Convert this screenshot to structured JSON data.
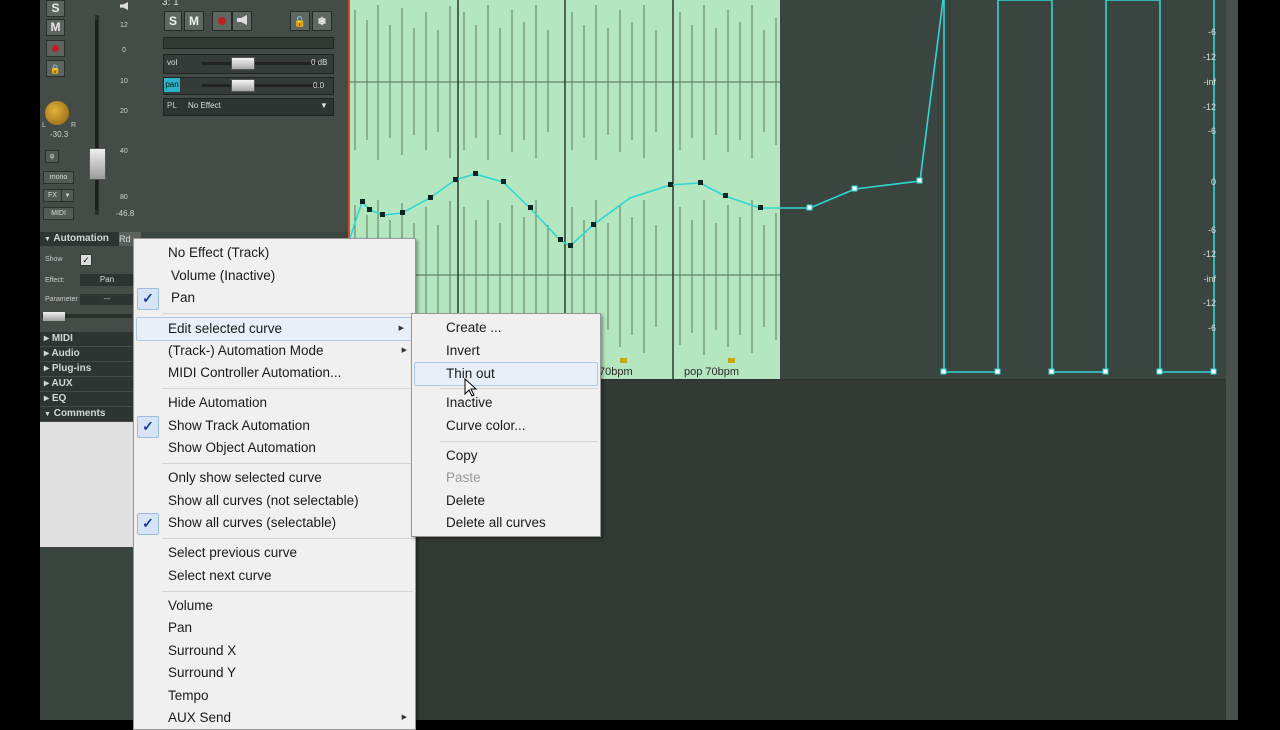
{
  "mixer": {
    "solo": "S",
    "mute": "M",
    "meter_scale": [
      "12",
      "0",
      "10",
      "20",
      "40",
      "80"
    ],
    "meter_value": "-46.8",
    "pan_value": "-30.3",
    "pan_left": "L",
    "pan_right": "R",
    "phase_label": "φ",
    "mono_label": "mono",
    "fx_label": "FX",
    "midi_label": "MIDI"
  },
  "track": {
    "name": "3: 1",
    "solo": "S",
    "mute": "M",
    "vol_label": "vol",
    "vol_value": "0 dB",
    "pan_label": "pan",
    "pan_value": "0.0",
    "pl_label": "PL",
    "effect": "No Effect"
  },
  "automation_panel": {
    "title": "Automation",
    "tab": "Rd",
    "show_label": "Show",
    "effect_label": "Effect:",
    "effect_value": "Pan",
    "parameter_label": "Parameter",
    "parameter_value": "---",
    "sections": [
      "MIDI",
      "Audio",
      "Plug-ins",
      "AUX",
      "EQ",
      "Comments"
    ]
  },
  "arrange": {
    "tempo_markers": [
      "70bpm",
      "pop 70bpm"
    ],
    "db_scale": [
      "-6",
      "-12",
      "-inf",
      "-12",
      "-6",
      "0",
      "-6",
      "-12",
      "-inf",
      "-12",
      "-6"
    ]
  },
  "context_menu": {
    "items": [
      {
        "label": "No Effect  (Track)"
      },
      {
        "label": "Volume (Inactive)"
      },
      {
        "label": "Pan",
        "checked": true
      },
      {
        "label": "Edit selected curve",
        "submenu": true,
        "highlighted": true
      },
      {
        "label": "(Track-) Automation Mode",
        "submenu": true
      },
      {
        "label": "MIDI Controller Automation..."
      },
      {
        "label": "Hide Automation"
      },
      {
        "label": "Show Track Automation",
        "checked": true
      },
      {
        "label": "Show Object Automation"
      },
      {
        "label": "Only show selected curve"
      },
      {
        "label": "Show all curves (not selectable)"
      },
      {
        "label": "Show all curves (selectable)",
        "checked": true
      },
      {
        "label": "Select previous curve"
      },
      {
        "label": "Select next curve"
      },
      {
        "label": "Volume"
      },
      {
        "label": "Pan"
      },
      {
        "label": "Surround X"
      },
      {
        "label": "Surround Y"
      },
      {
        "label": "Tempo"
      },
      {
        "label": "AUX Send",
        "submenu": true
      }
    ]
  },
  "submenu": {
    "items": [
      {
        "label": "Create ..."
      },
      {
        "label": "Invert"
      },
      {
        "label": "Thin out",
        "highlighted": true
      },
      {
        "label": "Inactive"
      },
      {
        "label": "Curve color..."
      },
      {
        "label": "Copy"
      },
      {
        "label": "Paste",
        "disabled": true
      },
      {
        "label": "Delete"
      },
      {
        "label": "Delete all curves"
      }
    ]
  },
  "colors": {
    "wave_bg": "#b4e6bf",
    "curve": "#2fd6d6",
    "app_bg": "#3b4540"
  }
}
